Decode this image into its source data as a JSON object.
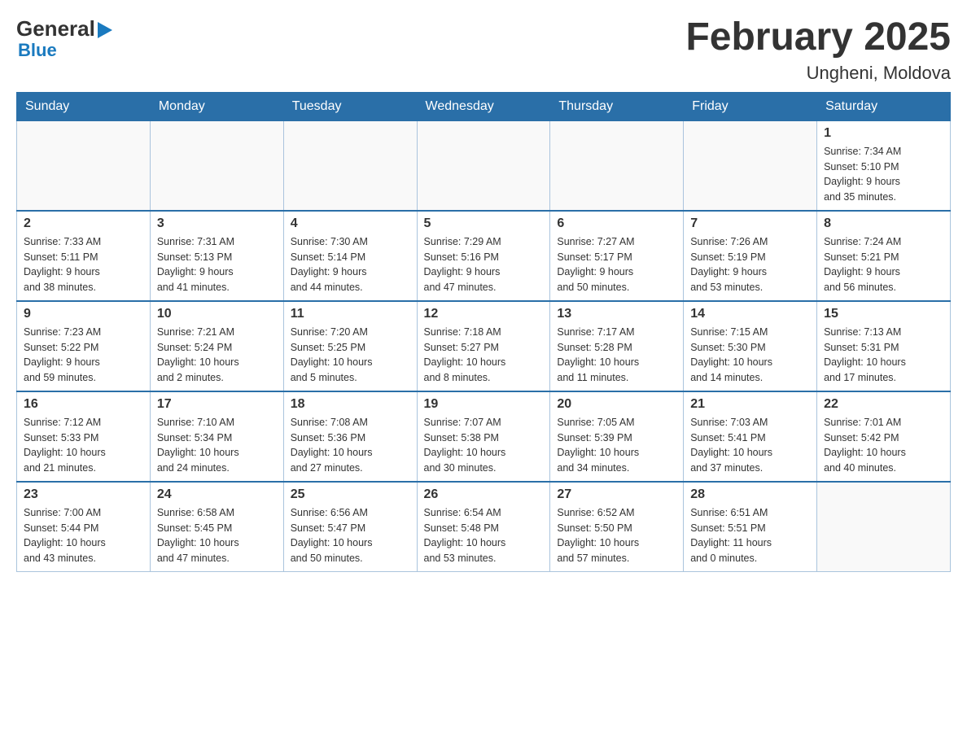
{
  "header": {
    "logo_general": "General",
    "logo_blue": "Blue",
    "title": "February 2025",
    "subtitle": "Ungheni, Moldova"
  },
  "calendar": {
    "days_of_week": [
      "Sunday",
      "Monday",
      "Tuesday",
      "Wednesday",
      "Thursday",
      "Friday",
      "Saturday"
    ],
    "weeks": [
      [
        {
          "day": "",
          "info": ""
        },
        {
          "day": "",
          "info": ""
        },
        {
          "day": "",
          "info": ""
        },
        {
          "day": "",
          "info": ""
        },
        {
          "day": "",
          "info": ""
        },
        {
          "day": "",
          "info": ""
        },
        {
          "day": "1",
          "info": "Sunrise: 7:34 AM\nSunset: 5:10 PM\nDaylight: 9 hours\nand 35 minutes."
        }
      ],
      [
        {
          "day": "2",
          "info": "Sunrise: 7:33 AM\nSunset: 5:11 PM\nDaylight: 9 hours\nand 38 minutes."
        },
        {
          "day": "3",
          "info": "Sunrise: 7:31 AM\nSunset: 5:13 PM\nDaylight: 9 hours\nand 41 minutes."
        },
        {
          "day": "4",
          "info": "Sunrise: 7:30 AM\nSunset: 5:14 PM\nDaylight: 9 hours\nand 44 minutes."
        },
        {
          "day": "5",
          "info": "Sunrise: 7:29 AM\nSunset: 5:16 PM\nDaylight: 9 hours\nand 47 minutes."
        },
        {
          "day": "6",
          "info": "Sunrise: 7:27 AM\nSunset: 5:17 PM\nDaylight: 9 hours\nand 50 minutes."
        },
        {
          "day": "7",
          "info": "Sunrise: 7:26 AM\nSunset: 5:19 PM\nDaylight: 9 hours\nand 53 minutes."
        },
        {
          "day": "8",
          "info": "Sunrise: 7:24 AM\nSunset: 5:21 PM\nDaylight: 9 hours\nand 56 minutes."
        }
      ],
      [
        {
          "day": "9",
          "info": "Sunrise: 7:23 AM\nSunset: 5:22 PM\nDaylight: 9 hours\nand 59 minutes."
        },
        {
          "day": "10",
          "info": "Sunrise: 7:21 AM\nSunset: 5:24 PM\nDaylight: 10 hours\nand 2 minutes."
        },
        {
          "day": "11",
          "info": "Sunrise: 7:20 AM\nSunset: 5:25 PM\nDaylight: 10 hours\nand 5 minutes."
        },
        {
          "day": "12",
          "info": "Sunrise: 7:18 AM\nSunset: 5:27 PM\nDaylight: 10 hours\nand 8 minutes."
        },
        {
          "day": "13",
          "info": "Sunrise: 7:17 AM\nSunset: 5:28 PM\nDaylight: 10 hours\nand 11 minutes."
        },
        {
          "day": "14",
          "info": "Sunrise: 7:15 AM\nSunset: 5:30 PM\nDaylight: 10 hours\nand 14 minutes."
        },
        {
          "day": "15",
          "info": "Sunrise: 7:13 AM\nSunset: 5:31 PM\nDaylight: 10 hours\nand 17 minutes."
        }
      ],
      [
        {
          "day": "16",
          "info": "Sunrise: 7:12 AM\nSunset: 5:33 PM\nDaylight: 10 hours\nand 21 minutes."
        },
        {
          "day": "17",
          "info": "Sunrise: 7:10 AM\nSunset: 5:34 PM\nDaylight: 10 hours\nand 24 minutes."
        },
        {
          "day": "18",
          "info": "Sunrise: 7:08 AM\nSunset: 5:36 PM\nDaylight: 10 hours\nand 27 minutes."
        },
        {
          "day": "19",
          "info": "Sunrise: 7:07 AM\nSunset: 5:38 PM\nDaylight: 10 hours\nand 30 minutes."
        },
        {
          "day": "20",
          "info": "Sunrise: 7:05 AM\nSunset: 5:39 PM\nDaylight: 10 hours\nand 34 minutes."
        },
        {
          "day": "21",
          "info": "Sunrise: 7:03 AM\nSunset: 5:41 PM\nDaylight: 10 hours\nand 37 minutes."
        },
        {
          "day": "22",
          "info": "Sunrise: 7:01 AM\nSunset: 5:42 PM\nDaylight: 10 hours\nand 40 minutes."
        }
      ],
      [
        {
          "day": "23",
          "info": "Sunrise: 7:00 AM\nSunset: 5:44 PM\nDaylight: 10 hours\nand 43 minutes."
        },
        {
          "day": "24",
          "info": "Sunrise: 6:58 AM\nSunset: 5:45 PM\nDaylight: 10 hours\nand 47 minutes."
        },
        {
          "day": "25",
          "info": "Sunrise: 6:56 AM\nSunset: 5:47 PM\nDaylight: 10 hours\nand 50 minutes."
        },
        {
          "day": "26",
          "info": "Sunrise: 6:54 AM\nSunset: 5:48 PM\nDaylight: 10 hours\nand 53 minutes."
        },
        {
          "day": "27",
          "info": "Sunrise: 6:52 AM\nSunset: 5:50 PM\nDaylight: 10 hours\nand 57 minutes."
        },
        {
          "day": "28",
          "info": "Sunrise: 6:51 AM\nSunset: 5:51 PM\nDaylight: 11 hours\nand 0 minutes."
        },
        {
          "day": "",
          "info": ""
        }
      ]
    ]
  }
}
